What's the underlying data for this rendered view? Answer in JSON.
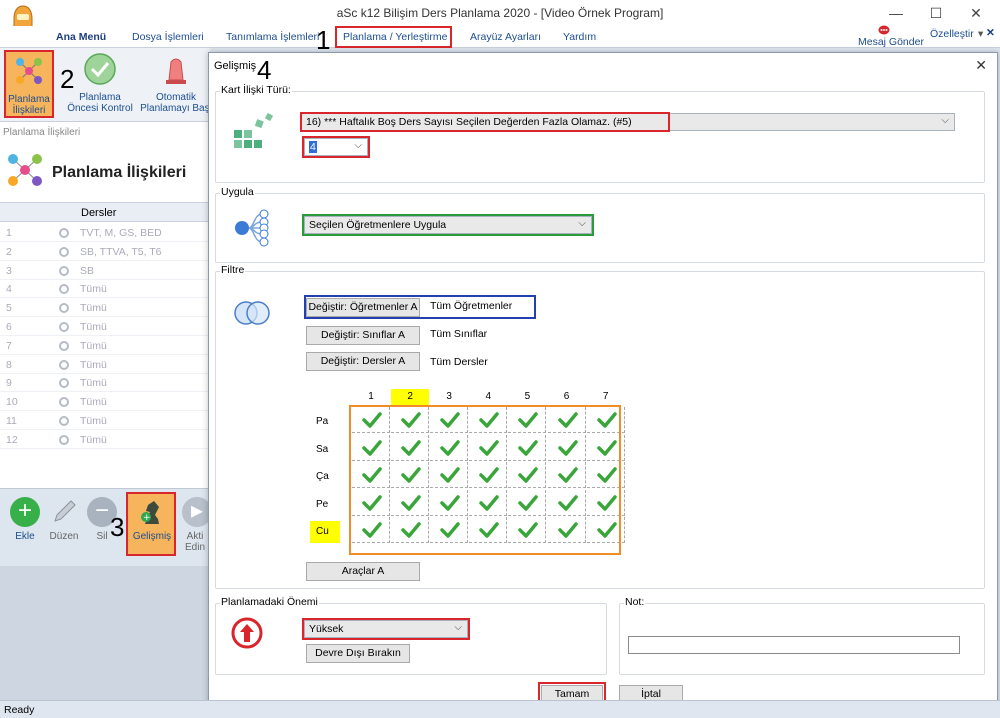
{
  "window": {
    "title": "aSc k12 Bilişim Ders Planlama 2020  - [Video Örnek Program]",
    "minimize": "—",
    "maximize": "☐",
    "close": "✕"
  },
  "menu": {
    "items": [
      "Ana Menü",
      "Dosya İşlemleri",
      "Tanımlama İşlemleri",
      "Planlama / Yerleştirme",
      "Arayüz Ayarları",
      "Yardım"
    ],
    "message_label": "Mesaj Gönder",
    "customize_label": "Özelleştir",
    "customize_arrow": "▾",
    "close_x": "✕"
  },
  "ribbon": {
    "btn1": "Planlama İlişkileri",
    "btn2_line1": "Planlama",
    "btn2_line2": "Öncesi Kontrol",
    "btn3_line1": "Otomatik",
    "btn3_line2": "Planlamayı Başl"
  },
  "left_panel": {
    "crumb": "Planlama İlişkileri",
    "title": "Planlama İlişkileri",
    "column_header": "Dersler",
    "rows": [
      {
        "num": "1",
        "val": "TVT, M, GS, BED"
      },
      {
        "num": "2",
        "val": "SB, TTVA, T5, T6"
      },
      {
        "num": "3",
        "val": "SB"
      },
      {
        "num": "4",
        "val": "Tümü"
      },
      {
        "num": "5",
        "val": "Tümü"
      },
      {
        "num": "6",
        "val": "Tümü"
      },
      {
        "num": "7",
        "val": "Tümü"
      },
      {
        "num": "8",
        "val": "Tümü"
      },
      {
        "num": "9",
        "val": "Tümü"
      },
      {
        "num": "10",
        "val": "Tümü"
      },
      {
        "num": "11",
        "val": "Tümü"
      },
      {
        "num": "12",
        "val": "Tümü"
      }
    ]
  },
  "bottom_toolbar": {
    "add": "Ekle",
    "edit": "Düzen",
    "delete": "Sil",
    "advanced": "Gelişmiş",
    "activate_line1": "Akti",
    "activate_line2": "Edin"
  },
  "annotations": {
    "n1": "1",
    "n2": "2",
    "n3": "3",
    "n4": "4"
  },
  "dialog": {
    "title": "Gelişmiş",
    "close": "✕",
    "card_relation_label": "Kart İlişki Türü:",
    "relation_value": "16) *** Haftalık Boş Ders Sayısı Seçilen Değerden Fazla Olamaz. (#5)",
    "number_value": "4",
    "apply_label": "Uygula",
    "apply_value": "Seçilen Öğretmenlere Uygula",
    "filter_label": "Filtre",
    "btn_teachers": "Değiştir: Öğretmenler A",
    "teachers_value": "Tüm Öğretmenler",
    "btn_classes": "Değiştir: Sınıflar A",
    "classes_value": "Tüm Sınıflar",
    "btn_subjects": "Değiştir: Dersler A",
    "subjects_value": "Tüm Dersler",
    "columns": [
      "1",
      "2",
      "3",
      "4",
      "5",
      "6",
      "7"
    ],
    "days": [
      "Pa",
      "Sa",
      "Ça",
      "Pe",
      "Cu"
    ],
    "tools_btn": "Araçlar A",
    "importance_label": "Planlamadaki Önemi",
    "importance_value": "Yüksek",
    "disable_btn": "Devre Dışı Bırakın",
    "note_label": "Not:",
    "ok_btn": "Tamam",
    "cancel_btn": "İptal"
  },
  "status": {
    "text": "Ready"
  },
  "colors": {
    "red": "#d9262c",
    "green": "#2a9b3a",
    "blue": "#2440b0",
    "orange": "#f08c2a",
    "yellow": "#ffff00",
    "check": "#3aa53a"
  }
}
